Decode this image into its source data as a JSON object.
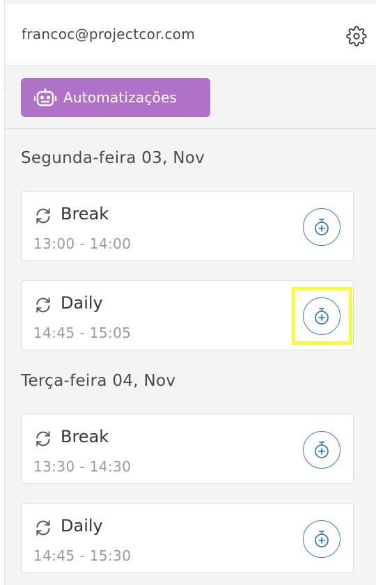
{
  "header": {
    "user_email": "francoc@projectcor.com",
    "settings_icon": "gear-icon"
  },
  "toolbar": {
    "automations_label": "Automatizações",
    "automations_icon": "robot-icon",
    "automations_color": "#b072c9"
  },
  "days": [
    {
      "heading": "Segunda-feira 03, Nov",
      "events": [
        {
          "title": "Break",
          "time": "13:00 - 14:00",
          "highlighted": false
        },
        {
          "title": "Daily",
          "time": "14:45 - 15:05",
          "highlighted": true
        }
      ]
    },
    {
      "heading": "Terça-feira 04, Nov",
      "events": [
        {
          "title": "Break",
          "time": "13:30 - 14:30",
          "highlighted": false
        },
        {
          "title": "Daily",
          "time": "14:45 - 15:30",
          "highlighted": false
        }
      ]
    }
  ],
  "colors": {
    "accent_blue": "#3b7ec4",
    "highlight": "#fafa3c"
  }
}
